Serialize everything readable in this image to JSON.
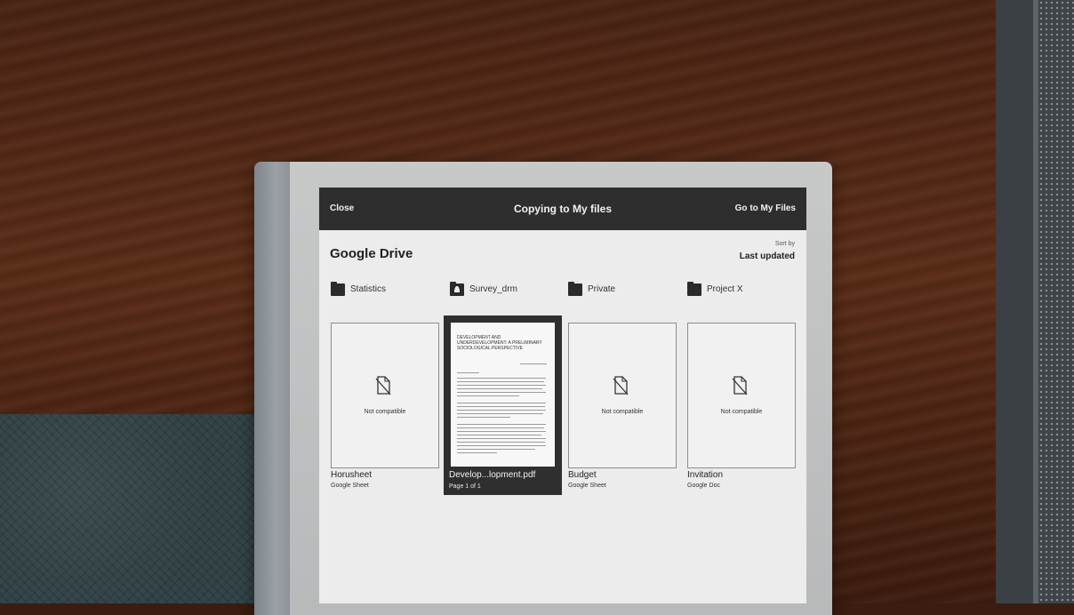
{
  "topbar": {
    "close_label": "Close",
    "title": "Copying to My files",
    "goto_label": "Go to My Files"
  },
  "section": {
    "title": "Google Drive",
    "sort_label": "Sort by",
    "sort_value": "Last updated"
  },
  "folders": [
    {
      "name": "Statistics",
      "icon": "folder-icon"
    },
    {
      "name": "Survey_drm",
      "icon": "shared-folder-icon"
    },
    {
      "name": "Private",
      "icon": "folder-icon"
    },
    {
      "name": "Project X",
      "icon": "folder-icon"
    }
  ],
  "files": [
    {
      "name": "Horusheet",
      "subtitle": "Google Sheet",
      "status": "Not compatible",
      "icon": "not-compatible-icon"
    },
    {
      "name": "Develop...lopment.pdf",
      "subtitle": "Page 1 of 1",
      "selected": true,
      "preview_heading": "DEVELOPMENT AND UNDERDEVELOPMENT: A PRELIMINARY SOCIOLOGICAL PERSPECTIVE"
    },
    {
      "name": "Budget",
      "subtitle": "Google Sheet",
      "status": "Not compatible",
      "icon": "not-compatible-icon"
    },
    {
      "name": "Invitation",
      "subtitle": "Google Doc",
      "status": "Not compatible",
      "icon": "not-compatible-icon"
    }
  ]
}
